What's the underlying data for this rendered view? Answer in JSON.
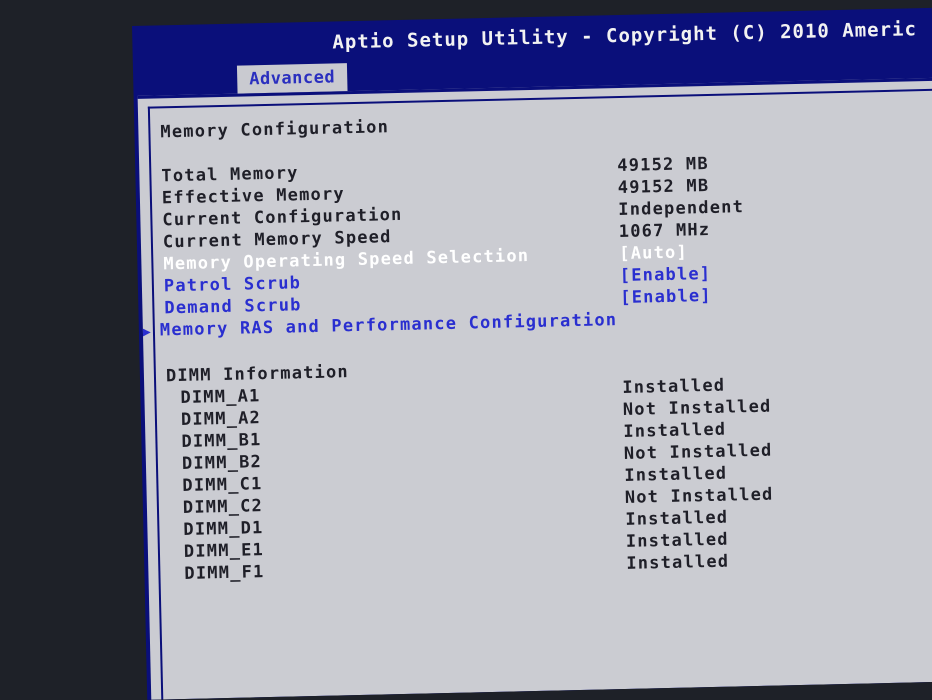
{
  "header": {
    "title": "Aptio Setup Utility - Copyright (C) 2010 Americ",
    "active_tab": "Advanced"
  },
  "section": {
    "title": "Memory Configuration"
  },
  "info": [
    {
      "label": "Total Memory",
      "value": "49152 MB"
    },
    {
      "label": "Effective Memory",
      "value": "49152 MB"
    },
    {
      "label": "Current Configuration",
      "value": "Independent"
    },
    {
      "label": "Current Memory Speed",
      "value": "1067 MHz"
    }
  ],
  "options": [
    {
      "label": "Memory Operating Speed Selection",
      "value": "[Auto]"
    },
    {
      "label": "Patrol Scrub",
      "value": "[Enable]"
    },
    {
      "label": "Demand Scrub",
      "value": "[Enable]"
    }
  ],
  "submenu": {
    "label": "Memory RAS and Performance Configuration"
  },
  "dimm": {
    "heading": "DIMM Information",
    "slots": [
      {
        "name": "DIMM_A1",
        "status": "Installed"
      },
      {
        "name": "DIMM_A2",
        "status": "Not Installed"
      },
      {
        "name": "DIMM_B1",
        "status": "Installed"
      },
      {
        "name": "DIMM_B2",
        "status": "Not Installed"
      },
      {
        "name": "DIMM_C1",
        "status": "Installed"
      },
      {
        "name": "DIMM_C2",
        "status": "Not Installed"
      },
      {
        "name": "DIMM_D1",
        "status": "Installed"
      },
      {
        "name": "DIMM_E1",
        "status": "Installed"
      },
      {
        "name": "DIMM_F1",
        "status": "Installed"
      }
    ]
  },
  "colors": {
    "bios_blue": "#0a0f7a",
    "panel_gray": "#cbccd2",
    "selectable_blue": "#2a2fd0",
    "highlight_white": "#ffffff",
    "text_dark": "#1f1f28"
  },
  "icons": {
    "submenu": "right-triangle-icon"
  }
}
